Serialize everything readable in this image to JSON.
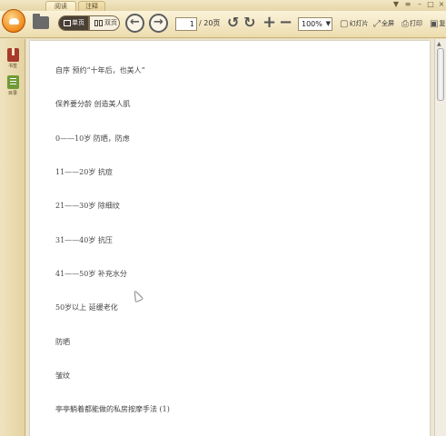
{
  "tabs": [
    {
      "label": "阅读"
    },
    {
      "label": "注释"
    }
  ],
  "toolbar": {
    "view_single_label": "单页",
    "view_double_label": "双页",
    "page_current": "1",
    "page_total": "/ 20页",
    "zoom_value": "100%",
    "slideshow_label": "幻灯片",
    "fullscreen_label": "全屏",
    "print_label": "打印",
    "more_label": "复"
  },
  "sidebar": {
    "items": [
      {
        "label": "书签",
        "icon": "bookmark-icon"
      },
      {
        "label": "目录",
        "icon": "toc-icon"
      }
    ]
  },
  "document": {
    "lines": [
      "自序  预约“十年后，也美人”",
      "保养要分龄  创造美人肌",
      "0——10岁  防晒，防虑",
      "11——20岁  抗痘",
      "21——30岁  除细纹",
      "31——40岁  抗压",
      "41——50岁  补充水分",
      "50岁以上  延缓老化",
      "防晒",
      "皱纹",
      "亭亭躺着都能做的私房按摩手法  (1)"
    ]
  }
}
